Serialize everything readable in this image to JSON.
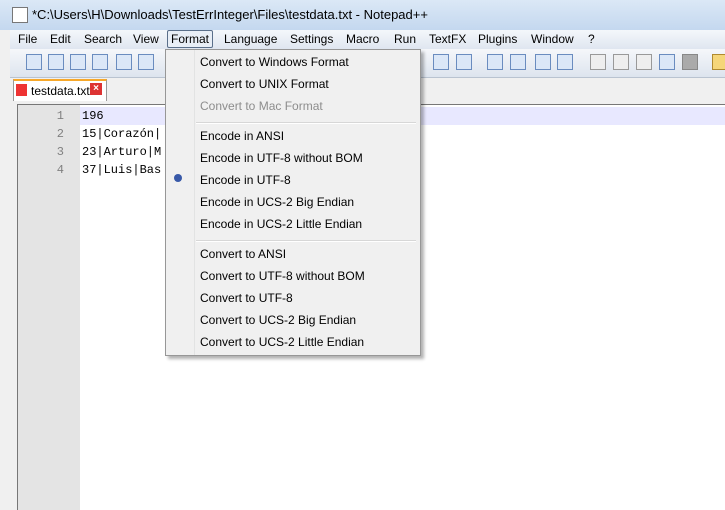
{
  "window": {
    "title": "*C:\\Users\\H\\Downloads\\TestErrInteger\\Files\\testdata.txt - Notepad++"
  },
  "menubar": [
    "File",
    "Edit",
    "Search",
    "View",
    "Format",
    "Language",
    "Settings",
    "Macro",
    "Run",
    "TextFX",
    "Plugins",
    "Window",
    "?"
  ],
  "tab": {
    "label": "testdata.txt"
  },
  "editor": {
    "line_numbers": [
      "1",
      "2",
      "3",
      "4"
    ],
    "lines": [
      "196",
      "15|Corazón|",
      "23|Arturo|M",
      "37|Luis|Bas"
    ]
  },
  "format_menu": {
    "items": [
      "Convert to Windows Format",
      "Convert to UNIX Format",
      "Convert to Mac Format",
      "Encode in ANSI",
      "Encode in UTF-8 without BOM",
      "Encode in UTF-8",
      "Encode in UCS-2 Big Endian",
      "Encode in UCS-2 Little Endian",
      "Convert to ANSI",
      "Convert to UTF-8 without BOM",
      "Convert to UTF-8",
      "Convert to UCS-2 Big Endian",
      "Convert to UCS-2 Little Endian"
    ],
    "checked": "Encode in UTF-8",
    "disabled": "Convert to Mac Format"
  }
}
